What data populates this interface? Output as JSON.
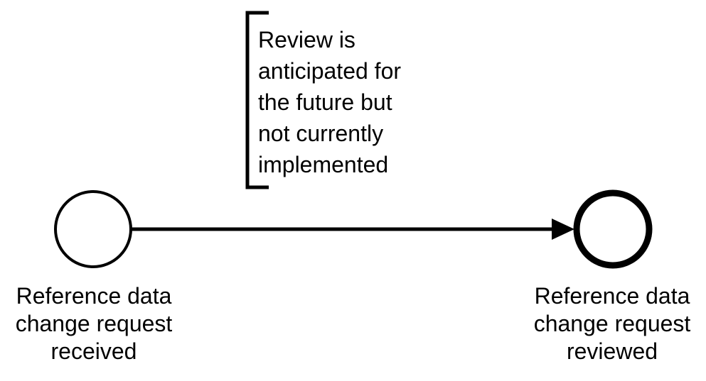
{
  "annotation": {
    "lines": [
      "Review is",
      "anticipated for",
      "the future but",
      "not currently",
      "implemented"
    ]
  },
  "start_event": {
    "label_lines": [
      "Reference data",
      "change request",
      "received"
    ]
  },
  "end_event": {
    "label_lines": [
      "Reference data",
      "change request",
      "reviewed"
    ]
  },
  "colors": {
    "stroke": "#000000",
    "background": "#ffffff"
  }
}
